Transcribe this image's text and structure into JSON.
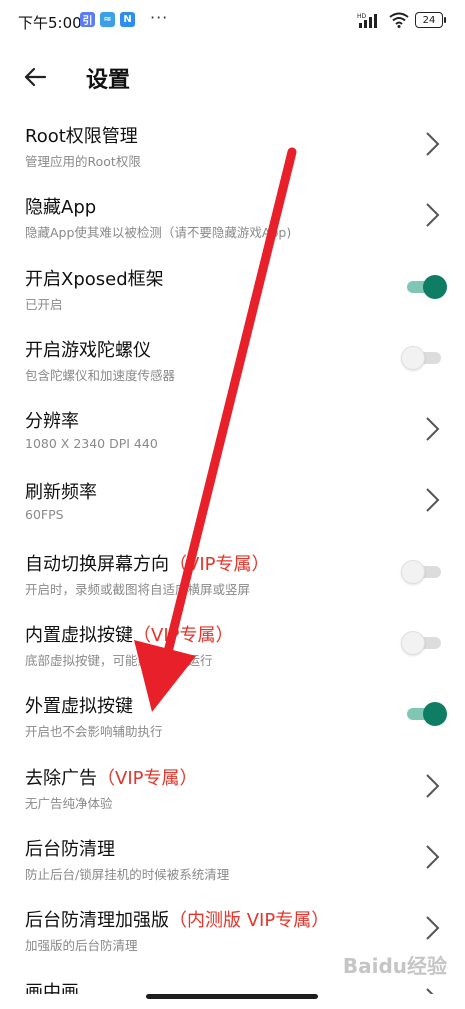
{
  "status_bar": {
    "time": "下午5:00",
    "apps": [
      {
        "icon": "app-badge-1",
        "label": "引",
        "color": "#5b7cf5"
      },
      {
        "icon": "app-badge-2",
        "label": "≈",
        "color": "#3aa0e8"
      },
      {
        "icon": "app-badge-3",
        "label": "N",
        "color": "#2f8cf0"
      }
    ],
    "more": "···",
    "network_label": "HD",
    "battery": "24"
  },
  "header": {
    "back_icon": "arrow-left-icon",
    "title": "设置"
  },
  "settings": [
    {
      "title": "Root权限管理",
      "vip": "",
      "subtitle": "管理应用的Root权限",
      "control": "chevron"
    },
    {
      "title": "隐藏App",
      "vip": "",
      "subtitle": "隐藏App使其难以被检测（请不要隐藏游戏App)",
      "control": "chevron"
    },
    {
      "title": "开启Xposed框架",
      "vip": "",
      "subtitle": "已开启",
      "control": "toggle",
      "on": true
    },
    {
      "title": "开启游戏陀螺仪",
      "vip": "",
      "subtitle": "包含陀螺仪和加速度传感器",
      "control": "toggle",
      "on": false
    },
    {
      "title": "分辨率",
      "vip": "",
      "subtitle": "1080 X 2340 DPI 440",
      "control": "chevron"
    },
    {
      "title": "刷新频率",
      "vip": "",
      "subtitle": "60FPS",
      "control": "chevron"
    },
    {
      "title": "自动切换屏幕方向",
      "vip": "（VIP专属）",
      "subtitle": "开启时，录频或截图将自适应横屏或竖屏",
      "control": "toggle",
      "on": false
    },
    {
      "title": "内置虚拟按键",
      "vip": "（VIP专属）",
      "subtitle": "底部虚拟按键，可能影响辅助运行",
      "control": "toggle",
      "on": false
    },
    {
      "title": "外置虚拟按键",
      "vip": "",
      "subtitle": "开启也不会影响辅助执行",
      "control": "toggle",
      "on": true
    },
    {
      "title": "去除广告",
      "vip": "（VIP专属）",
      "subtitle": "无广告纯净体验",
      "control": "chevron"
    },
    {
      "title": "后台防清理",
      "vip": "",
      "subtitle": "防止后台/锁屏挂机的时候被系统清理",
      "control": "chevron"
    },
    {
      "title": "后台防清理加强版",
      "vip": "（内测版 VIP专属）",
      "subtitle": "加强版的后台防清理",
      "control": "chevron"
    },
    {
      "title": "画中画",
      "vip": "",
      "subtitle": "",
      "control": "chevron"
    }
  ],
  "watermark": "Baidu经验",
  "colors": {
    "vip_red": "#e5352b",
    "toggle_on": "#0f7d64",
    "annotation_arrow": "#e8202a"
  }
}
